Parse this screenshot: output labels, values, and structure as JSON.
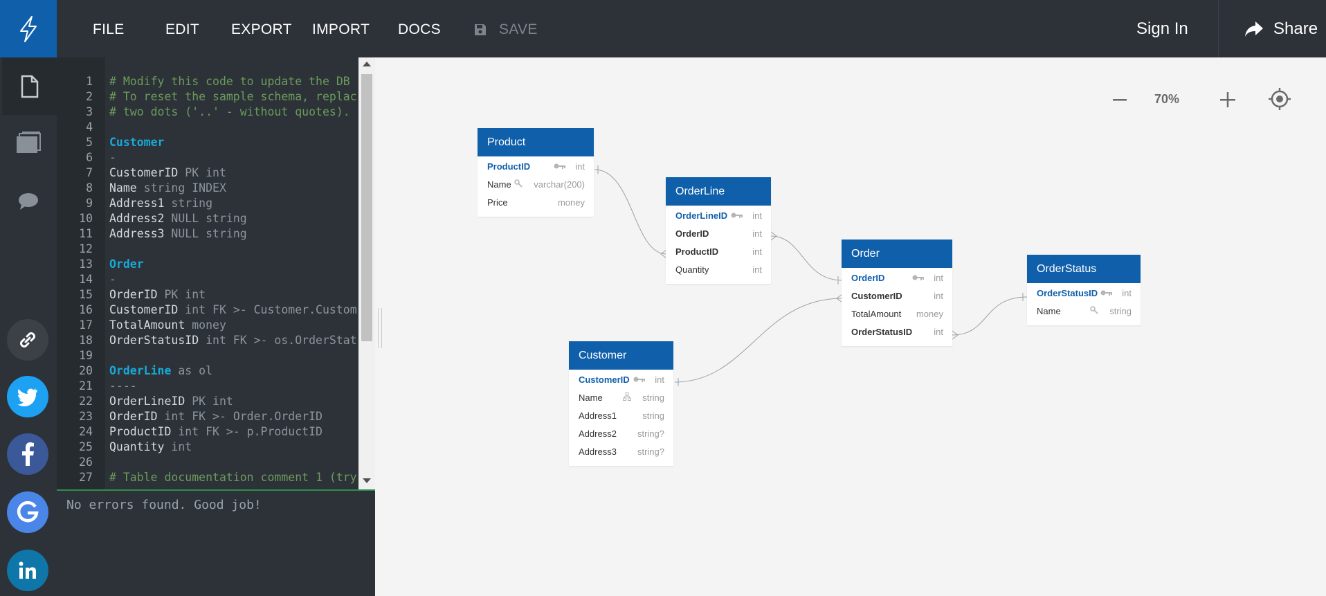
{
  "menu": {
    "file": "FILE",
    "edit": "EDIT",
    "export": "EXPORT",
    "import": "IMPORT",
    "docs": "DOCS",
    "save": "SAVE",
    "sign_in": "Sign In",
    "share": "Share"
  },
  "sidebar": {
    "icons": [
      "document-icon",
      "folder-icon",
      "chat-icon"
    ],
    "social": [
      {
        "name": "link-icon",
        "color": "#3c4148"
      },
      {
        "name": "twitter-icon",
        "color": "#1da1f2"
      },
      {
        "name": "facebook-icon",
        "color": "#3b5998"
      },
      {
        "name": "google-icon",
        "color": "#4a86e8"
      },
      {
        "name": "linkedin-icon",
        "color": "#0e76a8"
      }
    ]
  },
  "editor": {
    "lines": [
      {
        "n": "1",
        "text": "# Modify this code to update the DB",
        "kind": "comment"
      },
      {
        "n": "2",
        "text": "# To reset the sample schema, replac",
        "kind": "comment"
      },
      {
        "n": "3",
        "text": "# two dots ('..' - without quotes).",
        "kind": "comment"
      },
      {
        "n": "4",
        "text": "",
        "kind": "plain"
      },
      {
        "n": "5",
        "text": "Customer",
        "kind": "table"
      },
      {
        "n": "6",
        "text": "-",
        "kind": "type"
      },
      {
        "n": "7",
        "key": "CustomerID",
        "rest": " PK int",
        "kind": "field"
      },
      {
        "n": "8",
        "key": "Name",
        "rest": " string INDEX",
        "kind": "field"
      },
      {
        "n": "9",
        "key": "Address1",
        "rest": " string",
        "kind": "field"
      },
      {
        "n": "10",
        "key": "Address2",
        "rest": " NULL string",
        "kind": "field"
      },
      {
        "n": "11",
        "key": "Address3",
        "rest": " NULL string",
        "kind": "field"
      },
      {
        "n": "12",
        "text": "",
        "kind": "plain"
      },
      {
        "n": "13",
        "text": "Order",
        "kind": "table"
      },
      {
        "n": "14",
        "text": "-",
        "kind": "type"
      },
      {
        "n": "15",
        "key": "OrderID",
        "rest": " PK int",
        "kind": "field"
      },
      {
        "n": "16",
        "key": "CustomerID",
        "rest": " int FK >- Customer.Custom",
        "kind": "field"
      },
      {
        "n": "17",
        "key": "TotalAmount",
        "rest": " money",
        "kind": "field"
      },
      {
        "n": "18",
        "key": "OrderStatusID",
        "rest": " int FK >- os.OrderStat",
        "kind": "field"
      },
      {
        "n": "19",
        "text": "",
        "kind": "plain"
      },
      {
        "n": "20",
        "key": "OrderLine",
        "rest": " as ol",
        "kind": "tablealias"
      },
      {
        "n": "21",
        "text": "----",
        "kind": "type"
      },
      {
        "n": "22",
        "key": "OrderLineID",
        "rest": " PK int",
        "kind": "field"
      },
      {
        "n": "23",
        "key": "OrderID",
        "rest": " int FK >- Order.OrderID",
        "kind": "field"
      },
      {
        "n": "24",
        "key": "ProductID",
        "rest": " int FK >- p.ProductID",
        "kind": "field"
      },
      {
        "n": "25",
        "key": "Quantity",
        "rest": " int",
        "kind": "field"
      },
      {
        "n": "26",
        "text": "",
        "kind": "plain"
      },
      {
        "n": "27",
        "text": "# Table documentation comment 1 (try",
        "kind": "comment"
      }
    ]
  },
  "console": {
    "message": "No errors found. Good job!"
  },
  "canvas": {
    "zoom": "70%",
    "tables": [
      {
        "id": "product",
        "title": "Product",
        "rows": [
          {
            "name": "ProductID",
            "type": "int",
            "role": "pk",
            "icon": "key"
          },
          {
            "name": "Name",
            "type": "varchar(200)",
            "role": "plain",
            "icon": "index"
          },
          {
            "name": "Price",
            "type": "money",
            "role": "plain",
            "icon": ""
          }
        ]
      },
      {
        "id": "orderline",
        "title": "OrderLine",
        "rows": [
          {
            "name": "OrderLineID",
            "type": "int",
            "role": "pk",
            "icon": "key"
          },
          {
            "name": "OrderID",
            "type": "int",
            "role": "fk",
            "icon": ""
          },
          {
            "name": "ProductID",
            "type": "int",
            "role": "fk",
            "icon": ""
          },
          {
            "name": "Quantity",
            "type": "int",
            "role": "plain",
            "icon": ""
          }
        ]
      },
      {
        "id": "order",
        "title": "Order",
        "rows": [
          {
            "name": "OrderID",
            "type": "int",
            "role": "pk",
            "icon": "key"
          },
          {
            "name": "CustomerID",
            "type": "int",
            "role": "fk",
            "icon": ""
          },
          {
            "name": "TotalAmount",
            "type": "money",
            "role": "plain",
            "icon": ""
          },
          {
            "name": "OrderStatusID",
            "type": "int",
            "role": "fk",
            "icon": ""
          }
        ]
      },
      {
        "id": "orderstatus",
        "title": "OrderStatus",
        "rows": [
          {
            "name": "OrderStatusID",
            "type": "int",
            "role": "pk",
            "icon": "key"
          },
          {
            "name": "Name",
            "type": "string",
            "role": "plain",
            "icon": "index"
          }
        ]
      },
      {
        "id": "customer",
        "title": "Customer",
        "rows": [
          {
            "name": "CustomerID",
            "type": "int",
            "role": "pk",
            "icon": "key"
          },
          {
            "name": "Name",
            "type": "string",
            "role": "plain",
            "icon": "index-tree"
          },
          {
            "name": "Address1",
            "type": "string",
            "role": "plain",
            "icon": ""
          },
          {
            "name": "Address2",
            "type": "string?",
            "role": "plain",
            "icon": ""
          },
          {
            "name": "Address3",
            "type": "string?",
            "role": "plain",
            "icon": ""
          }
        ]
      }
    ]
  },
  "colors": {
    "brand": "#0f5fab",
    "chrome": "#2c3238",
    "comment": "#6b9b5b",
    "table_keyword": "#19a9d8"
  }
}
